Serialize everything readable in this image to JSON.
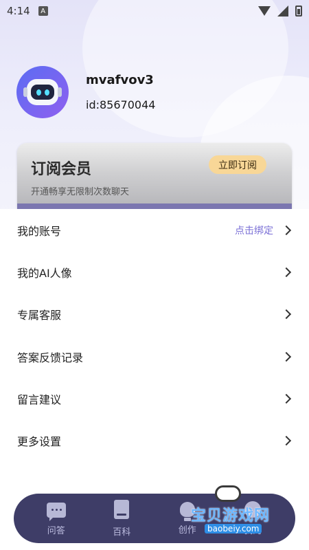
{
  "status_bar": {
    "time": "4:14",
    "notification_icon": "A"
  },
  "profile": {
    "username": "mvafvov3",
    "user_id": "id:85670044"
  },
  "vip": {
    "title": "订阅会员",
    "subtitle": "开通畅享无限制次数聊天",
    "button": "立即订阅"
  },
  "menu": {
    "items": [
      {
        "label": "我的账号",
        "extra": "点击绑定"
      },
      {
        "label": "我的AI人像"
      },
      {
        "label": "专属客服"
      },
      {
        "label": "答案反馈记录"
      },
      {
        "label": "留言建议"
      },
      {
        "label": "更多设置"
      }
    ]
  },
  "bottom_nav": {
    "items": [
      {
        "label": "问答",
        "icon": "chat-icon"
      },
      {
        "label": "百科",
        "icon": "book-icon"
      },
      {
        "label": "创作",
        "icon": "bulb-icon"
      },
      {
        "label": "我的",
        "icon": "mine-icon"
      }
    ]
  },
  "watermark": {
    "text": "宝贝游戏网",
    "url": "baobeiy.com"
  },
  "colors": {
    "accent": "#7a6fd6",
    "nav_bg": "#3e3d67",
    "vip_button": "#f8d797"
  }
}
